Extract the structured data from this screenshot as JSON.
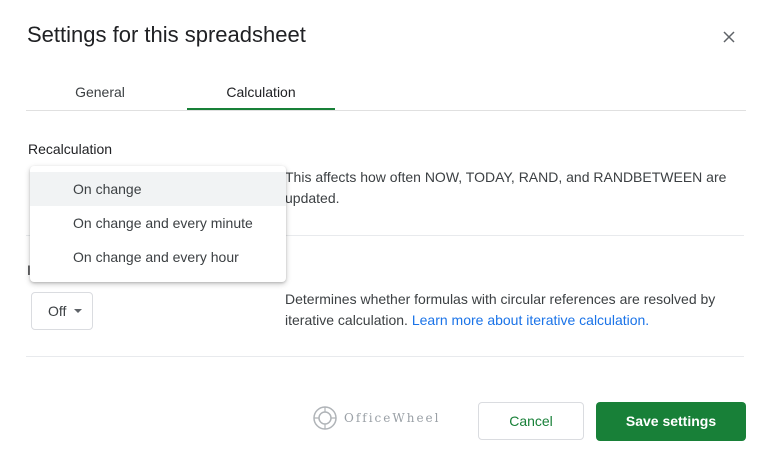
{
  "dialog": {
    "title": "Settings for this spreadsheet",
    "close_icon": "close-icon"
  },
  "tabs": [
    {
      "label": "General",
      "selected": false
    },
    {
      "label": "Calculation",
      "selected": true
    }
  ],
  "recalculation": {
    "label": "Recalculation",
    "description": "This affects how often NOW, TODAY, RAND, and RANDBETWEEN are updated.",
    "menu": {
      "options": [
        "On change",
        "On change and every minute",
        "On change and every hour"
      ],
      "highlighted": "On change"
    }
  },
  "iterative": {
    "label": "I",
    "value": "Off",
    "description": "Determines whether formulas with circular references are resolved by iterative calculation.",
    "link": "Learn more about iterative calculation."
  },
  "watermark": {
    "text": "OfficeWheel"
  },
  "buttons": {
    "cancel": "Cancel",
    "save": "Save settings"
  },
  "colors": {
    "accent": "#188038",
    "link": "#1a73e8"
  }
}
